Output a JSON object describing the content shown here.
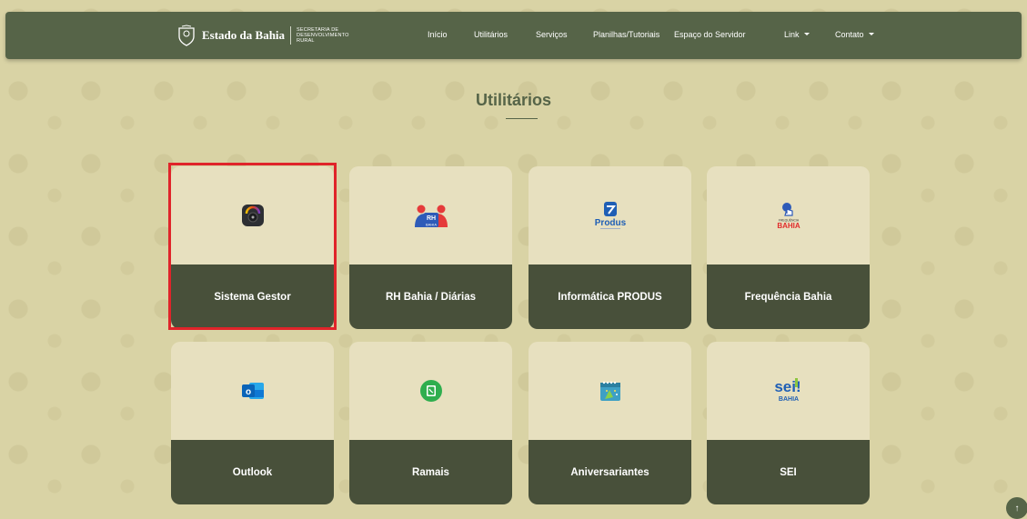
{
  "brand": {
    "name": "Estado da Bahia",
    "subtitle": "Secretaria de Desenvolvimento Rural"
  },
  "nav": {
    "items": [
      {
        "label": "Início"
      },
      {
        "label": "Utilitários"
      },
      {
        "label": "Serviços"
      },
      {
        "label": "Planilhas/Tutoriais"
      },
      {
        "label": "Espaço do Servidor"
      },
      {
        "label": "Link"
      },
      {
        "label": "Contato"
      }
    ]
  },
  "page": {
    "title": "Utilitários"
  },
  "cards": [
    {
      "label": "Sistema Gestor",
      "icon": "gauge-app-icon"
    },
    {
      "label": "RH Bahia / Diárias",
      "icon": "rh-bahia-logo",
      "logo_text": "RH",
      "logo_sub": "BAHIA"
    },
    {
      "label": "Informática PRODUS",
      "icon": "produs-logo",
      "logo_text": "Produs"
    },
    {
      "label": "Frequência Bahia",
      "icon": "frequencia-bahia-logo",
      "logo_text": "BAHIA",
      "logo_sub": "FREQUÊNCIA"
    },
    {
      "label": "Outlook",
      "icon": "outlook-icon",
      "logo_text": "o"
    },
    {
      "label": "Ramais",
      "icon": "phone-contacts-icon"
    },
    {
      "label": "Aniversariantes",
      "icon": "calendar-party-icon"
    },
    {
      "label": "SEI",
      "icon": "sei-bahia-logo",
      "logo_text": "sei!",
      "logo_sub": "BAHIA"
    }
  ],
  "colors": {
    "navbar": "#566448",
    "card_footer": "#48503a",
    "card_body": "#e7e0bf",
    "background": "#d9d3a5",
    "highlight": "#e0242a"
  }
}
